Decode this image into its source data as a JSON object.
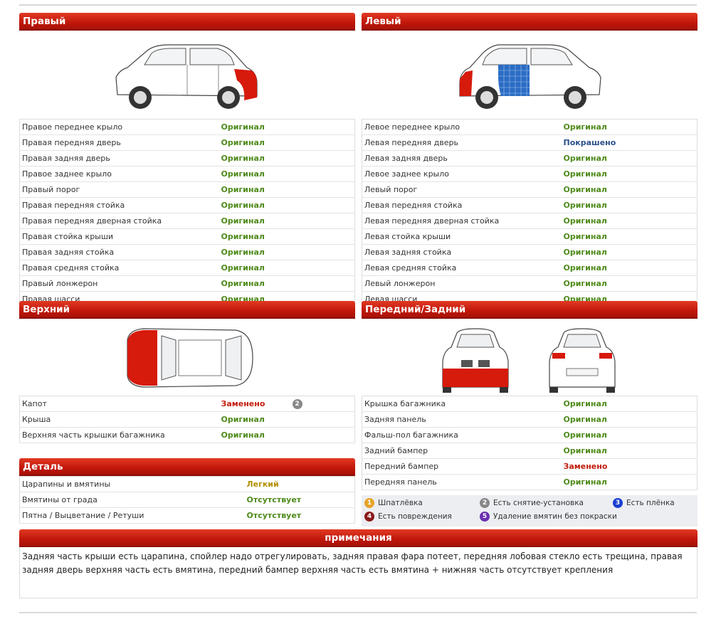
{
  "right": {
    "title": "Правый",
    "rows": [
      {
        "name": "Правое переднее крыло",
        "value": "Оригинал"
      },
      {
        "name": "Правая передняя дверь",
        "value": "Оригинал"
      },
      {
        "name": "Правая задняя дверь",
        "value": "Оригинал"
      },
      {
        "name": "Правое заднее крыло",
        "value": "Оригинал"
      },
      {
        "name": "Правый порог",
        "value": "Оригинал"
      },
      {
        "name": "Правая передняя стойка",
        "value": "Оригинал"
      },
      {
        "name": "Правая передняя дверная стойка",
        "value": "Оригинал"
      },
      {
        "name": "Правая стойка крыши",
        "value": "Оригинал"
      },
      {
        "name": "Правая задняя стойка",
        "value": "Оригинал"
      },
      {
        "name": "Правая средняя стойка",
        "value": "Оригинал"
      },
      {
        "name": "Правый лонжерон",
        "value": "Оригинал"
      },
      {
        "name": "Правая шасси",
        "value": "Оригинал"
      }
    ]
  },
  "left": {
    "title": "Левый",
    "rows": [
      {
        "name": "Левое переднее крыло",
        "value": "Оригинал"
      },
      {
        "name": "Левая передняя дверь",
        "value": "Покрашено"
      },
      {
        "name": "Левая задняя дверь",
        "value": "Оригинал"
      },
      {
        "name": "Левое заднее крыло",
        "value": "Оригинал"
      },
      {
        "name": "Левый порог",
        "value": "Оригинал"
      },
      {
        "name": "Левая передняя стойка",
        "value": "Оригинал"
      },
      {
        "name": "Левая передняя дверная стойка",
        "value": "Оригинал"
      },
      {
        "name": "Левая стойка крыши",
        "value": "Оригинал"
      },
      {
        "name": "Левая задняя стойка",
        "value": "Оригинал"
      },
      {
        "name": "Левая средняя стойка",
        "value": "Оригинал"
      },
      {
        "name": "Левый лонжерон",
        "value": "Оригинал"
      },
      {
        "name": "Левая шасси",
        "value": "Оригинал"
      }
    ]
  },
  "top": {
    "title": "Верхний",
    "rows": [
      {
        "name": "Капот",
        "value": "Заменено",
        "badge": "2"
      },
      {
        "name": "Крыша",
        "value": "Оригинал"
      },
      {
        "name": "Верхняя часть крышки багажника",
        "value": "Оригинал"
      }
    ]
  },
  "frontrear": {
    "title": "Передний/Задний",
    "rows": [
      {
        "name": "Крышка багажника",
        "value": "Оригинал"
      },
      {
        "name": "Задняя панель",
        "value": "Оригинал"
      },
      {
        "name": "Фальш-пол багажника",
        "value": "Оригинал"
      },
      {
        "name": "Задний бампер",
        "value": "Оригинал"
      },
      {
        "name": "Передний бампер",
        "value": "Заменено"
      },
      {
        "name": "Передняя панель",
        "value": "Оригинал"
      }
    ]
  },
  "detail": {
    "title": "Деталь",
    "rows": [
      {
        "name": "Царапины и вмятины",
        "value": "Легкий"
      },
      {
        "name": "Вмятины от града",
        "value": "Отсутствует"
      },
      {
        "name": "Пятна / Выцветание / Ретуши",
        "value": "Отсутствует"
      }
    ]
  },
  "legend": [
    {
      "num": "1",
      "label": "Шпатлёвка"
    },
    {
      "num": "2",
      "label": "Есть снятие-установка"
    },
    {
      "num": "3",
      "label": "Есть плёнка"
    },
    {
      "num": "4",
      "label": "Есть повреждения"
    },
    {
      "num": "5",
      "label": "Удаление вмятин без покраски"
    }
  ],
  "notes": {
    "title": "примечания",
    "text": "Задняя часть крыши есть царапина, спойлер надо отрегулировать, задняя правая фара потеет, передняя лобовая стекло есть трещина, правая задняя дверь верхняя часть есть вмятина, передний бампер верхняя часть есть вмятина + нижняя часть отсутствует крепления"
  },
  "colors": {
    "header": "#c0170a",
    "original": "#4e8a1a",
    "painted": "#2a4f8a",
    "replaced": "#c21d0c",
    "light": "#b28f00",
    "damage_red": "#d61a0c",
    "paint_blue": "#2b6cc4"
  }
}
